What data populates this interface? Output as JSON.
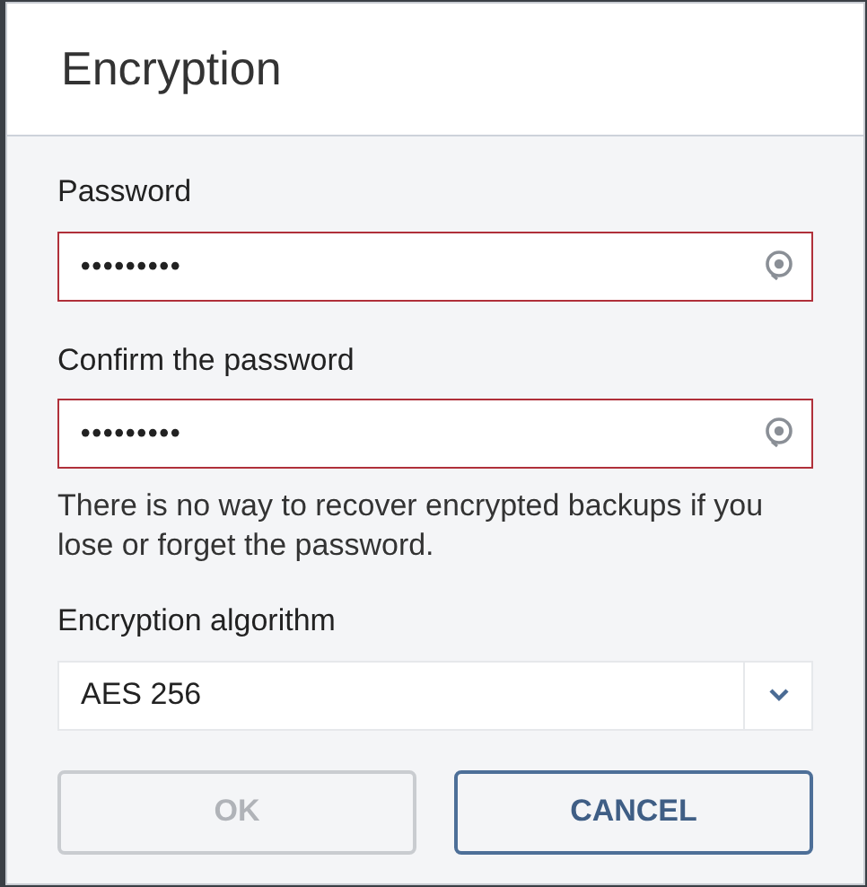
{
  "dialog": {
    "title": "Encryption"
  },
  "fields": [
    {
      "label": "Password",
      "value": "•••••••••",
      "invalid": true
    },
    {
      "label": "Confirm the password",
      "value": "•••••••••",
      "invalid": true
    }
  ],
  "note": "There is no way to recover encrypted backups if you lose or forget the password.",
  "algorithm": {
    "label": "Encryption algorithm",
    "value": "AES 256"
  },
  "buttons": [
    {
      "label": "OK",
      "disabled": true
    },
    {
      "label": "CANCEL",
      "disabled": false
    }
  ]
}
